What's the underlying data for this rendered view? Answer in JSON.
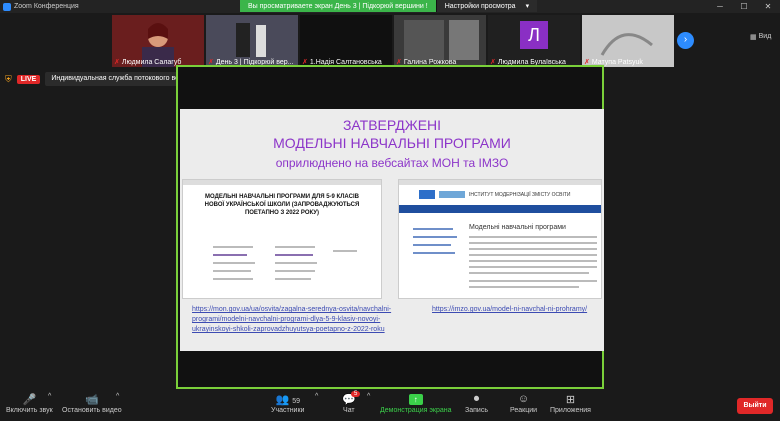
{
  "window": {
    "title": "Zoom Конференция",
    "min": "─",
    "max": "☐",
    "close": "✕"
  },
  "share_banner": {
    "message": "Вы просматриваете экран День 3 | Підкорюй вершини !",
    "options": "Настройки просмотра",
    "options_caret": "▾"
  },
  "participants": [
    {
      "name": "Людмила Салагуб",
      "muted": true,
      "bg": "#5a1a1a"
    },
    {
      "name": "День 3 | Підкорюй вер...",
      "muted": true,
      "bg": "#3a3a4a"
    },
    {
      "name": "1.Надія Салтановська",
      "muted": true,
      "bg": "#101010"
    },
    {
      "name": "Галина Рожкова",
      "muted": true,
      "bg": "#3a3a3a"
    },
    {
      "name": "Людмила Булаївська",
      "muted": true,
      "bg": "#202020",
      "avatar": "Л",
      "avatar_color": "#8a2fc4"
    },
    {
      "name": "Матупа Patsyuk",
      "muted": true,
      "bg": "#bdbdbd"
    }
  ],
  "next_icon": "›",
  "view": {
    "icon": "▦",
    "label": "Вид"
  },
  "livebar": {
    "live": "LIVE",
    "stream": "Индивидуальная служба потокового вещания",
    "caret": "▾"
  },
  "slide": {
    "title1": "ЗАТВЕРДЖЕНІ",
    "title2": "МОДЕЛЬНІ НАВЧАЛЬНІ ПРОГРАМИ",
    "title3": "оприлюднено на вебсайтах МОН та ІМЗО",
    "shot1_heading": "МОДЕЛЬНІ НАВЧАЛЬНІ ПРОГРАМИ ДЛЯ 5-9 КЛАСІВ НОВОЇ УКРАЇНСЬКОЇ ШКОЛИ (ЗАПРОВАДЖУЮТЬСЯ ПОЕТАПНО З 2022 РОКУ)",
    "shot2_header": "ІНСТИТУТ МОДЕРНІЗАЦІЇ ЗМІСТУ ОСВІТИ",
    "shot2_title": "Модельні навчальні програми",
    "link1": "https://mon.gov.ua/ua/osvita/zagalna-serednya-osvita/navchalni-programi/modelni-navchalni-programi-dlya-5-9-klasiv-novoyi-ukrayinskoyi-shkoli-zaprovadzhuyutsya-poetapno-z-2022-roku",
    "link2": "https://imzo.gov.ua/model-ni-navchal-ni-prohramy/"
  },
  "toolbar": {
    "mic": {
      "label": "Включить звук",
      "icon": "🎤"
    },
    "video": {
      "label": "Остановить видео",
      "icon": "📹"
    },
    "participants": {
      "label": "Участники",
      "count": "59",
      "icon": "👥"
    },
    "chat": {
      "label": "Чат",
      "badge": "5",
      "icon": "💬"
    },
    "share": {
      "label": "Демонстрация экрана",
      "icon": "↑"
    },
    "record": {
      "label": "Запись",
      "icon": "⏺"
    },
    "reactions": {
      "label": "Реакции",
      "icon": "☺"
    },
    "apps": {
      "label": "Приложения",
      "icon": "⊞"
    },
    "caret": "^",
    "exit": "Выйти"
  }
}
